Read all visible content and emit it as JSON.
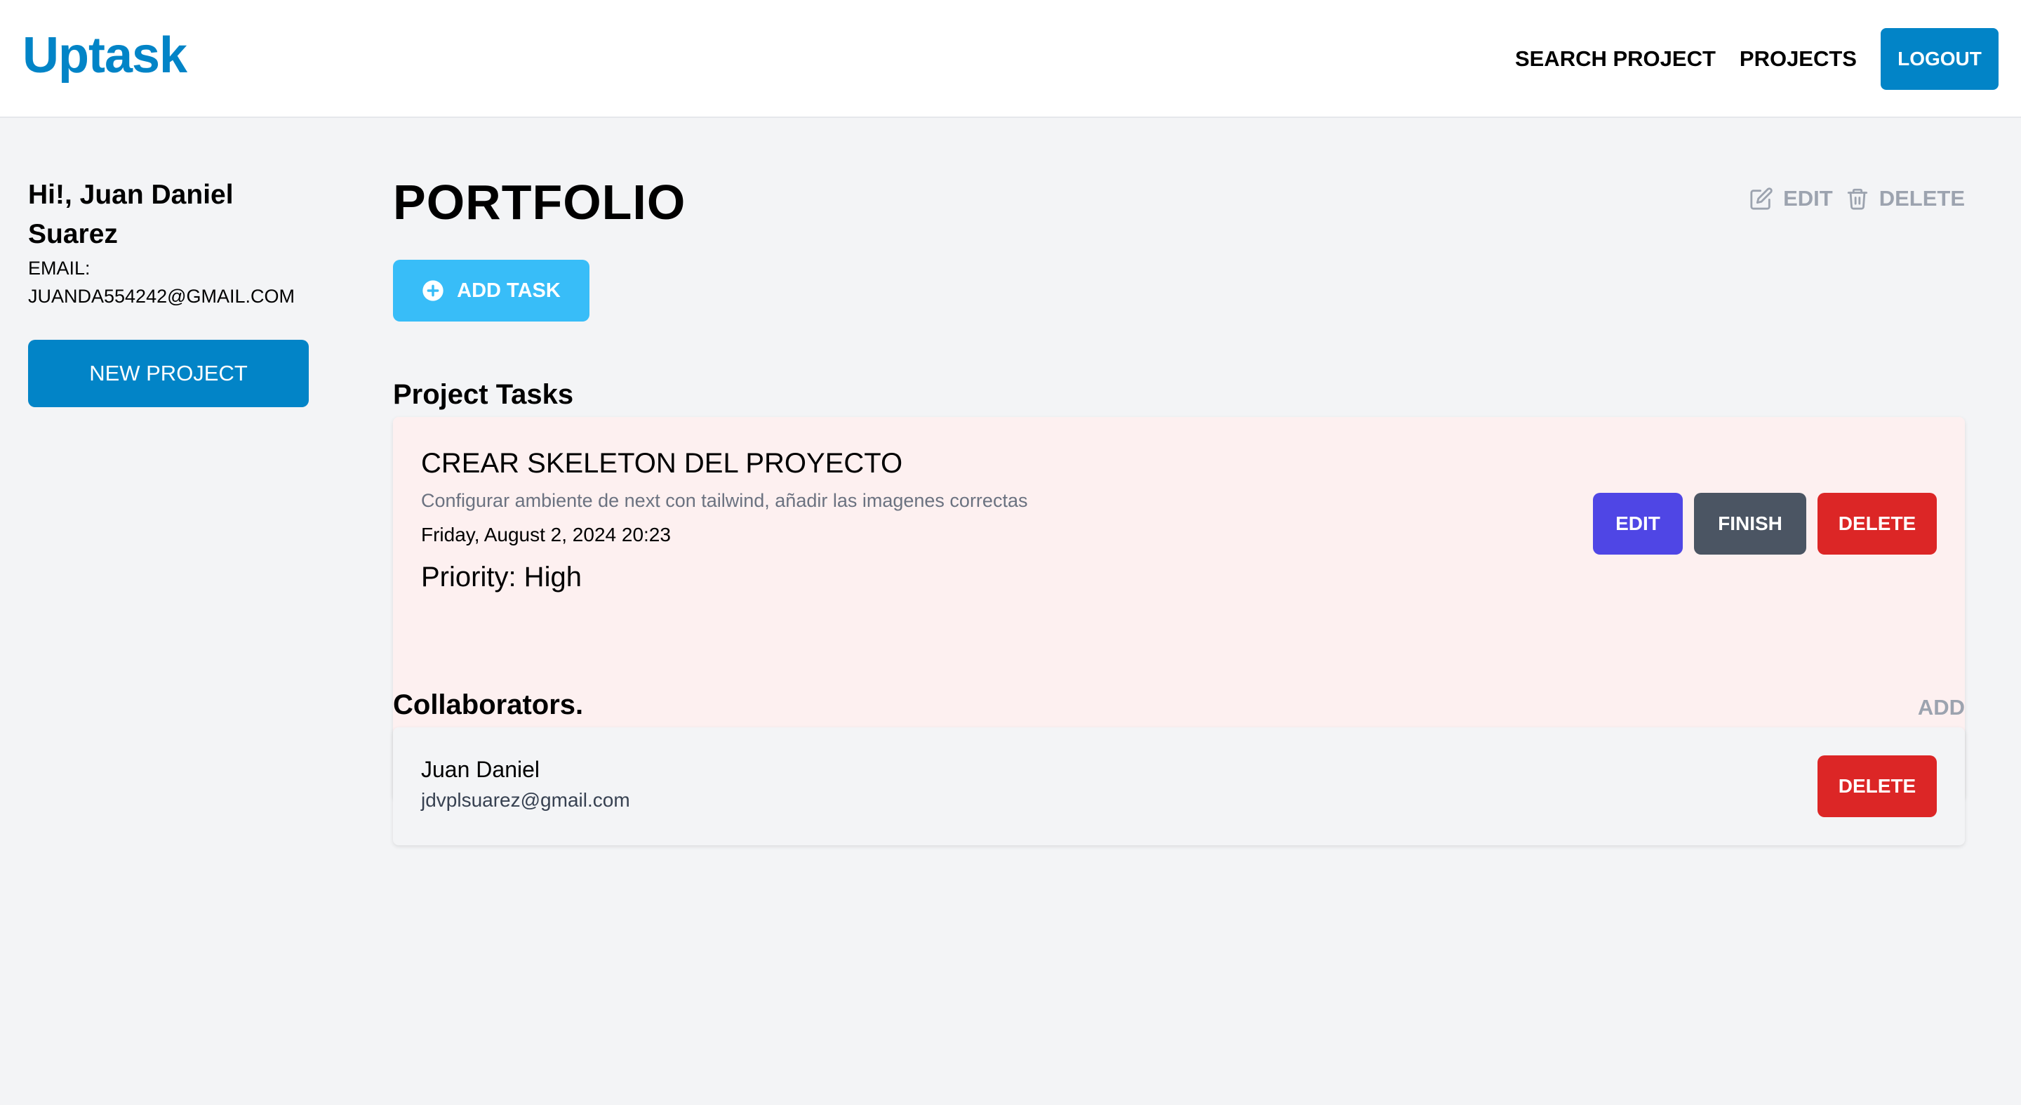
{
  "header": {
    "logo": "Uptask",
    "nav": {
      "search_project": "SEARCH PROJECT",
      "projects": "PROJECTS",
      "logout": "LOGOUT"
    }
  },
  "sidebar": {
    "greeting": "Hi!, Juan Daniel Suarez",
    "email_label": "EMAIL:",
    "email_value": "JUANDA554242@GMAIL.COM",
    "new_project": "NEW PROJECT"
  },
  "project": {
    "title": "PORTFOLIO",
    "edit_label": "EDIT",
    "delete_label": "DELETE",
    "add_task_label": "ADD TASK"
  },
  "tasks": {
    "section_title": "Project Tasks",
    "items": [
      {
        "name": "CREAR SKELETON DEL PROYECTO",
        "description": "Configurar ambiente de next con tailwind, añadir las imagenes correctas",
        "date": "Friday, August 2, 2024 20:23",
        "priority": "Priority: High",
        "edit_label": "EDIT",
        "finish_label": "FINISH",
        "delete_label": "DELETE"
      }
    ]
  },
  "collaborators": {
    "section_title": "Collaborators.",
    "add_label": "ADD",
    "items": [
      {
        "name": "Juan Daniel",
        "email": "jdvplsuarez@gmail.com",
        "delete_label": "DELETE"
      }
    ]
  },
  "colors": {
    "brand": "#0284c7",
    "add_task": "#38bdf8",
    "edit": "#4f46e5",
    "finish": "#4b5563",
    "delete": "#dc2626",
    "task_card_bg": "#fdf0f0",
    "muted": "#9ca3af"
  },
  "icons": {
    "project_edit": "pencil-square-icon",
    "project_delete": "trash-icon",
    "add_task": "plus-circle-icon"
  }
}
